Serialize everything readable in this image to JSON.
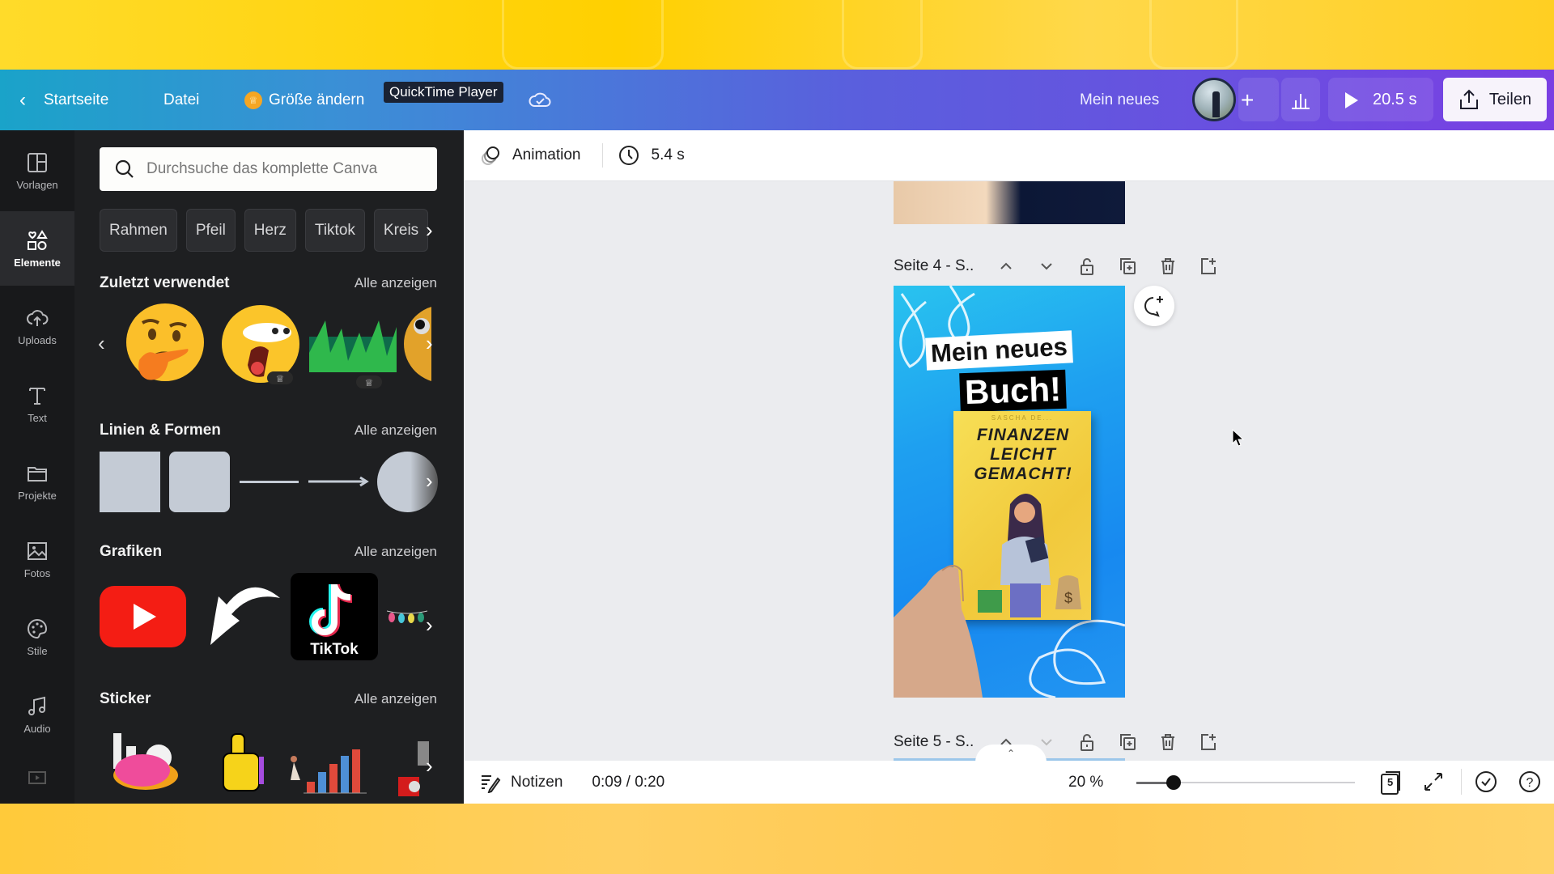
{
  "header": {
    "back_label": "Startseite",
    "file_menu": "Datei",
    "resize_label": "Größe ändern",
    "tooltip": "QuickTime Player",
    "design_title": "Mein neues",
    "play_duration": "20.5 s",
    "share_label": "Teilen"
  },
  "rail": {
    "items": [
      {
        "label": "Vorlagen",
        "icon": "template-icon"
      },
      {
        "label": "Elemente",
        "icon": "elements-icon",
        "active": true
      },
      {
        "label": "Uploads",
        "icon": "upload-cloud-icon"
      },
      {
        "label": "Text",
        "icon": "text-icon"
      },
      {
        "label": "Projekte",
        "icon": "folder-icon"
      },
      {
        "label": "Fotos",
        "icon": "photo-icon"
      },
      {
        "label": "Stile",
        "icon": "palette-icon"
      },
      {
        "label": "Audio",
        "icon": "music-icon"
      }
    ]
  },
  "panel": {
    "search_placeholder": "Durchsuche das komplette Canva",
    "chips": [
      "Rahmen",
      "Pfeil",
      "Herz",
      "Tiktok",
      "Kreis"
    ],
    "sections": {
      "recent": {
        "title": "Zuletzt verwendet",
        "see_all": "Alle anzeigen"
      },
      "shapes": {
        "title": "Linien & Formen",
        "see_all": "Alle anzeigen"
      },
      "graphics": {
        "title": "Grafiken",
        "see_all": "Alle anzeigen"
      },
      "stickers": {
        "title": "Sticker",
        "see_all": "Alle anzeigen"
      }
    },
    "tiktok_label": "TikTok"
  },
  "toolbar": {
    "animation_label": "Animation",
    "duration": "5.4 s"
  },
  "canvas": {
    "page4_label": "Seite 4 - S..",
    "page5_label": "Seite 5 - S..",
    "design_text_line1": "Mein neues",
    "design_text_line2": "Buch!",
    "book_author": "SASCHA DE...",
    "book_title": "FINANZEN LEICHT GEMACHT!"
  },
  "bottombar": {
    "notes_label": "Notizen",
    "timecode": "0:09 / 0:20",
    "zoom_level": "20 %",
    "zoom_fraction": 0.17,
    "page_count": "5"
  }
}
